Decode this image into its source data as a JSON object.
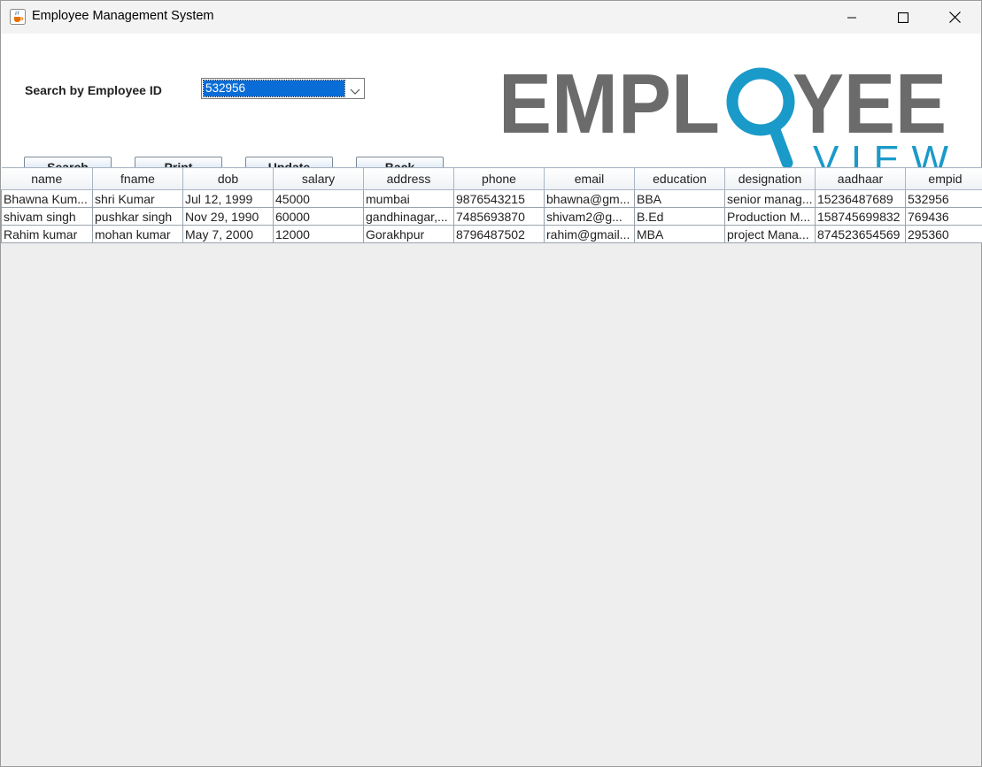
{
  "window": {
    "title": "Employee Management System"
  },
  "search": {
    "label": "Search by Employee ID",
    "selected_value": "532956"
  },
  "buttons": {
    "search": "Search",
    "print": "Print",
    "update": "Update",
    "back": "Back"
  },
  "logo": {
    "line1": "EMPLOYEE",
    "line2": "VIEW",
    "colors": {
      "gray": "#6b6b6b",
      "blue": "#1a9ac9"
    }
  },
  "table": {
    "columns": [
      "name",
      "fname",
      "dob",
      "salary",
      "address",
      "phone",
      "email",
      "education",
      "designation",
      "aadhaar",
      "empid"
    ],
    "rows": [
      [
        "Bhawna Kum...",
        "shri Kumar",
        "Jul 12, 1999",
        "45000",
        "mumbai",
        "9876543215",
        "bhawna@gm...",
        "BBA",
        "senior manag...",
        "15236487689",
        "532956"
      ],
      [
        "shivam singh",
        "pushkar singh",
        "Nov 29, 1990",
        "60000",
        "gandhinagar,...",
        "7485693870",
        "shivam2@g...",
        "B.Ed",
        "Production M...",
        "158745699832",
        "769436"
      ],
      [
        "Rahim kumar",
        "mohan kumar",
        "May 7, 2000",
        "12000",
        "Gorakhpur",
        "8796487502",
        "rahim@gmail...",
        "MBA",
        "project Mana...",
        "874523654569",
        "295360"
      ]
    ]
  }
}
